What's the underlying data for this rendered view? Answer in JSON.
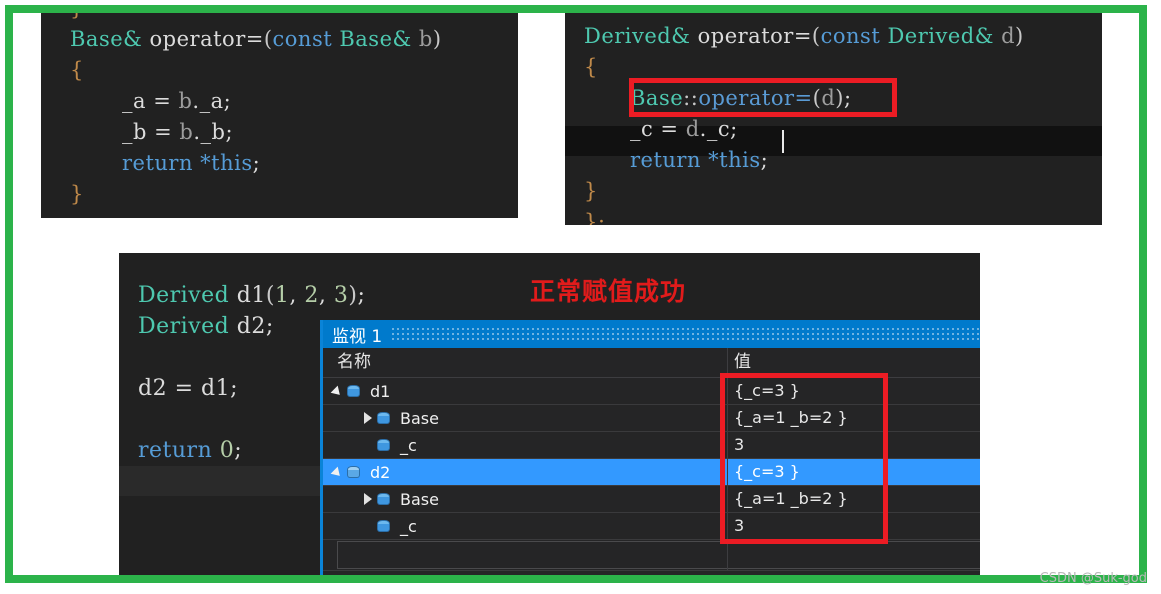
{
  "frame": {
    "accent_color": "#2cb34a"
  },
  "panels": {
    "base_operator": {
      "name": "Base::operator= source panel",
      "lines": [
        {
          "indent": 0,
          "segments": [
            {
              "t": "}",
              "c": "brace"
            }
          ]
        },
        {
          "indent": 0,
          "segments": [
            {
              "t": "Base&",
              "c": "type"
            },
            {
              "t": " operator=",
              "c": "plain"
            },
            {
              "t": "(",
              "c": "punct"
            },
            {
              "t": "const ",
              "c": "kw"
            },
            {
              "t": "Base&",
              "c": "type"
            },
            {
              "t": " b",
              "c": "var"
            },
            {
              "t": ")",
              "c": "punct"
            }
          ]
        },
        {
          "indent": 0,
          "segments": [
            {
              "t": "{",
              "c": "brace"
            }
          ]
        },
        {
          "indent": 2,
          "segments": [
            {
              "t": "_a = ",
              "c": "plain"
            },
            {
              "t": "b",
              "c": "var"
            },
            {
              "t": "._a;",
              "c": "plain"
            }
          ]
        },
        {
          "indent": 2,
          "segments": [
            {
              "t": "_b = ",
              "c": "plain"
            },
            {
              "t": "b",
              "c": "var"
            },
            {
              "t": "._b;",
              "c": "plain"
            }
          ]
        },
        {
          "indent": 2,
          "segments": [
            {
              "t": "return ",
              "c": "kw"
            },
            {
              "t": "*this",
              "c": "kw"
            },
            {
              "t": ";",
              "c": "plain"
            }
          ]
        },
        {
          "indent": 0,
          "segments": [
            {
              "t": "}",
              "c": "brace"
            }
          ]
        }
      ]
    },
    "derived_operator": {
      "name": "Derived::operator= source panel",
      "lines": [
        {
          "indent": 0,
          "segments": [
            {
              "t": "Derived&",
              "c": "type"
            },
            {
              "t": " operator=",
              "c": "plain"
            },
            {
              "t": "(",
              "c": "punct"
            },
            {
              "t": "const ",
              "c": "kw"
            },
            {
              "t": "Derived&",
              "c": "type"
            },
            {
              "t": " d",
              "c": "var"
            },
            {
              "t": ")",
              "c": "punct"
            }
          ]
        },
        {
          "indent": 0,
          "segments": [
            {
              "t": "{",
              "c": "brace"
            }
          ]
        },
        {
          "indent": 1,
          "segments": [
            {
              "t": "Base",
              "c": "type"
            },
            {
              "t": "::",
              "c": "punct"
            },
            {
              "t": "operator=",
              "c": "fn"
            },
            {
              "t": "(",
              "c": "punct"
            },
            {
              "t": "d",
              "c": "var"
            },
            {
              "t": ")",
              "c": "punct"
            },
            {
              "t": ";",
              "c": "plain"
            }
          ]
        },
        {
          "indent": 1,
          "segments": [
            {
              "t": "_c = ",
              "c": "plain"
            },
            {
              "t": "d",
              "c": "var"
            },
            {
              "t": "._c;",
              "c": "plain"
            }
          ]
        },
        {
          "indent": 1,
          "segments": [
            {
              "t": "return ",
              "c": "kw"
            },
            {
              "t": "*this",
              "c": "kw"
            },
            {
              "t": ";",
              "c": "plain"
            }
          ]
        },
        {
          "indent": 0,
          "segments": [
            {
              "t": "}",
              "c": "brace"
            }
          ]
        },
        {
          "indent": 0,
          "segments": [
            {
              "t": "};",
              "c": "brace"
            }
          ]
        }
      ]
    },
    "main_function": {
      "name": "main() source panel",
      "lines": [
        {
          "indent": 0,
          "segments": [
            {
              "t": "Derived",
              "c": "type"
            },
            {
              "t": " d1",
              "c": "plain"
            },
            {
              "t": "(",
              "c": "punct"
            },
            {
              "t": "1",
              "c": "num"
            },
            {
              "t": ", ",
              "c": "plain"
            },
            {
              "t": "2",
              "c": "num"
            },
            {
              "t": ", ",
              "c": "plain"
            },
            {
              "t": "3",
              "c": "num"
            },
            {
              "t": ")",
              "c": "punct"
            },
            {
              "t": ";",
              "c": "plain"
            }
          ]
        },
        {
          "indent": 0,
          "segments": [
            {
              "t": "Derived",
              "c": "type"
            },
            {
              "t": " d2;",
              "c": "plain"
            }
          ]
        },
        {
          "indent": 0,
          "segments": [
            {
              "t": "",
              "c": "plain"
            }
          ]
        },
        {
          "indent": 0,
          "segments": [
            {
              "t": "d2 = d1;",
              "c": "plain"
            }
          ]
        },
        {
          "indent": 0,
          "segments": [
            {
              "t": "",
              "c": "plain"
            }
          ]
        },
        {
          "indent": 0,
          "segments": [
            {
              "t": "return ",
              "c": "kw"
            },
            {
              "t": "0",
              "c": "num"
            },
            {
              "t": ";",
              "c": "plain"
            }
          ]
        }
      ]
    }
  },
  "annotations": {
    "assign_ok_label": "正常赋值成功",
    "label_color": "#e11b1b",
    "box_color": "#ec1c24",
    "boxes": [
      {
        "name": "highlight-base-operator-call",
        "target": "Base::operator=(d);"
      },
      {
        "name": "highlight-watch-values",
        "target": "watch value column"
      }
    ]
  },
  "watch_window": {
    "title": "监视 1",
    "columns": [
      "名称",
      "值"
    ],
    "rows": [
      {
        "indent": 0,
        "twisty": "expanded",
        "icon": "variable-box-icon",
        "name": "d1",
        "value": "{_c=3 }",
        "selected": false
      },
      {
        "indent": 1,
        "twisty": "collapsed",
        "icon": "variable-box-icon",
        "name": "Base",
        "value": "{_a=1 _b=2 }",
        "selected": false
      },
      {
        "indent": 1,
        "twisty": "none",
        "icon": "variable-box-icon",
        "name": "_c",
        "value": "3",
        "selected": false
      },
      {
        "indent": 0,
        "twisty": "expanded",
        "icon": "variable-box-icon",
        "name": "d2",
        "value": "{_c=3 }",
        "selected": true
      },
      {
        "indent": 1,
        "twisty": "collapsed",
        "icon": "variable-box-icon",
        "name": "Base",
        "value": "{_a=1 _b=2 }",
        "selected": false
      },
      {
        "indent": 1,
        "twisty": "none",
        "icon": "variable-box-icon",
        "name": "_c",
        "value": "3",
        "selected": false
      }
    ],
    "blank_row": "",
    "selection_color": "#3399ff",
    "titlebar_color": "#007acc"
  },
  "watermark": "CSDN @Suk-god"
}
